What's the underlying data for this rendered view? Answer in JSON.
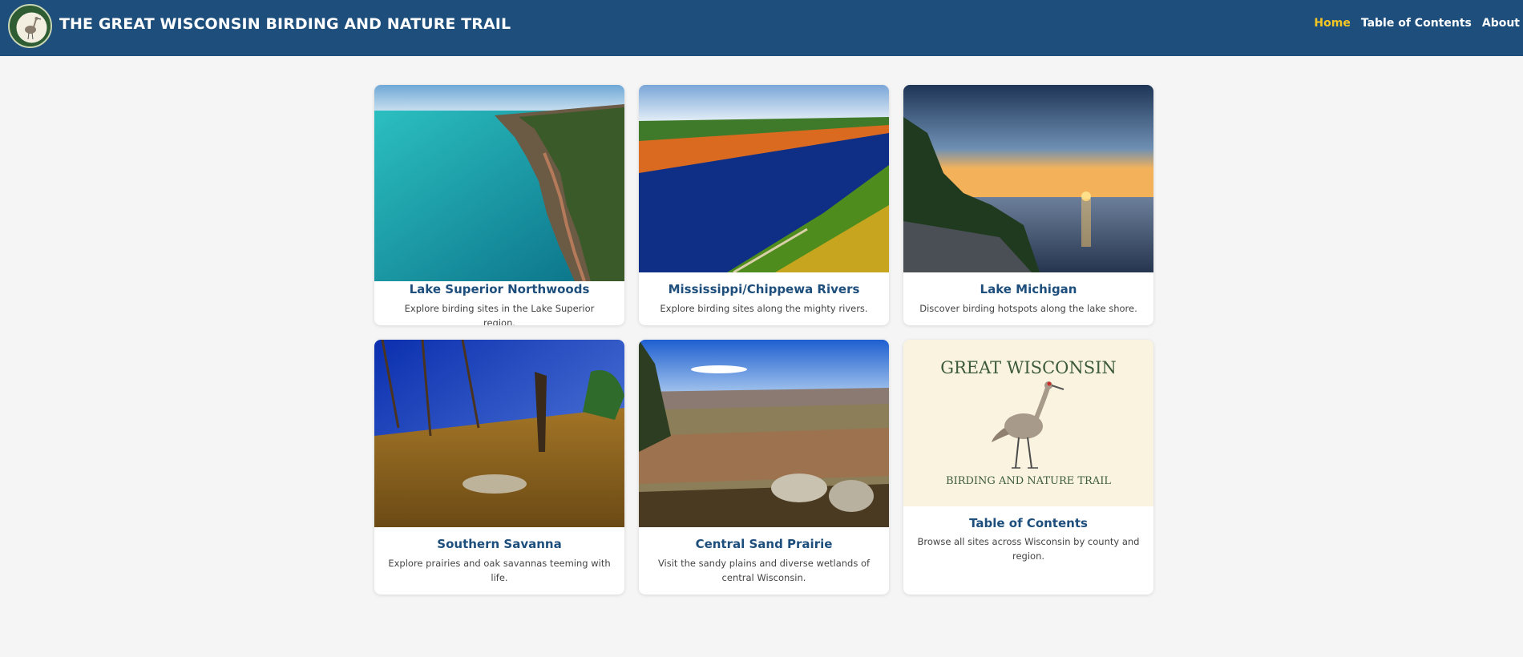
{
  "header": {
    "site_title": "THE GREAT WISCONSIN BIRDING AND NATURE TRAIL",
    "logo_icon": "crane-logo-icon",
    "nav": [
      {
        "label": "Home",
        "active": true
      },
      {
        "label": "Table of Contents",
        "active": false
      },
      {
        "label": "About",
        "active": false
      }
    ],
    "bg_color": "#1d4e7c",
    "active_color": "#f3c623"
  },
  "cards": [
    {
      "title": "Lake Superior Northwoods",
      "description": "Explore birding sites in the Lake Superior region.",
      "image": "lake-superior-cliffs-photo"
    },
    {
      "title": "Mississippi/Chippewa Rivers",
      "description": "Explore birding sites along the mighty rivers.",
      "image": "river-autumn-aerial-photo"
    },
    {
      "title": "Lake Michigan",
      "description": "Discover birding hotspots along the lake shore.",
      "image": "lake-michigan-sunset-photo"
    },
    {
      "title": "Southern Savanna",
      "description": "Explore prairies and oak savannas teeming with life.",
      "image": "savanna-hillside-photo"
    },
    {
      "title": "Central Sand Prairie",
      "description": "Visit the sandy plains and diverse wetlands of central Wisconsin.",
      "image": "sand-prairie-overlook-photo"
    },
    {
      "title": "Table of Contents",
      "description": "Browse all sites across Wisconsin by county and region.",
      "image": "crane-illustration"
    }
  ],
  "crane_graphic": {
    "top_text": "GREAT WISCONSIN",
    "bottom_text": "BIRDING AND NATURE TRAIL"
  }
}
